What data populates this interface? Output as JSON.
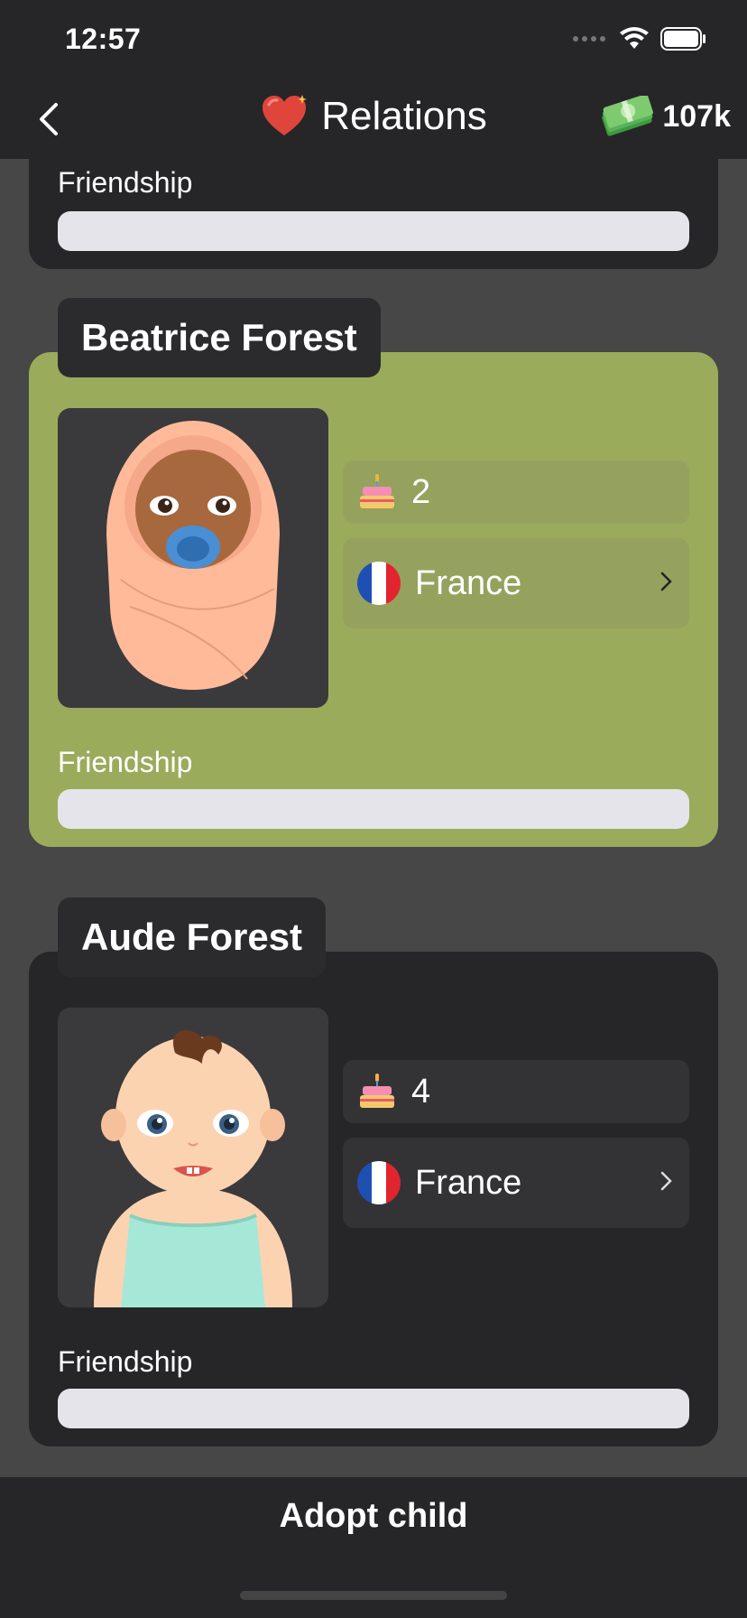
{
  "status": {
    "time": "12:57"
  },
  "nav": {
    "title": "Relations",
    "money": "107k"
  },
  "cards": [
    {
      "friendship_label": "Friendship"
    },
    {
      "name": "Beatrice Forest",
      "age": "2",
      "country": "France",
      "friendship_label": "Friendship"
    },
    {
      "name": "Aude Forest",
      "age": "4",
      "country": "France",
      "friendship_label": "Friendship"
    }
  ],
  "footer": {
    "adopt_label": "Adopt child"
  },
  "colors": {
    "card_dark": "#262628",
    "card_green": "#9aab5c",
    "background": "#474747",
    "bar": "#e4e4ea"
  },
  "icons": [
    "back-chevron-icon",
    "heart-icon",
    "money-stack-icon",
    "birthday-cake-icon",
    "france-flag-icon",
    "chevron-right-icon",
    "wifi-icon",
    "battery-icon",
    "signal-icon"
  ]
}
